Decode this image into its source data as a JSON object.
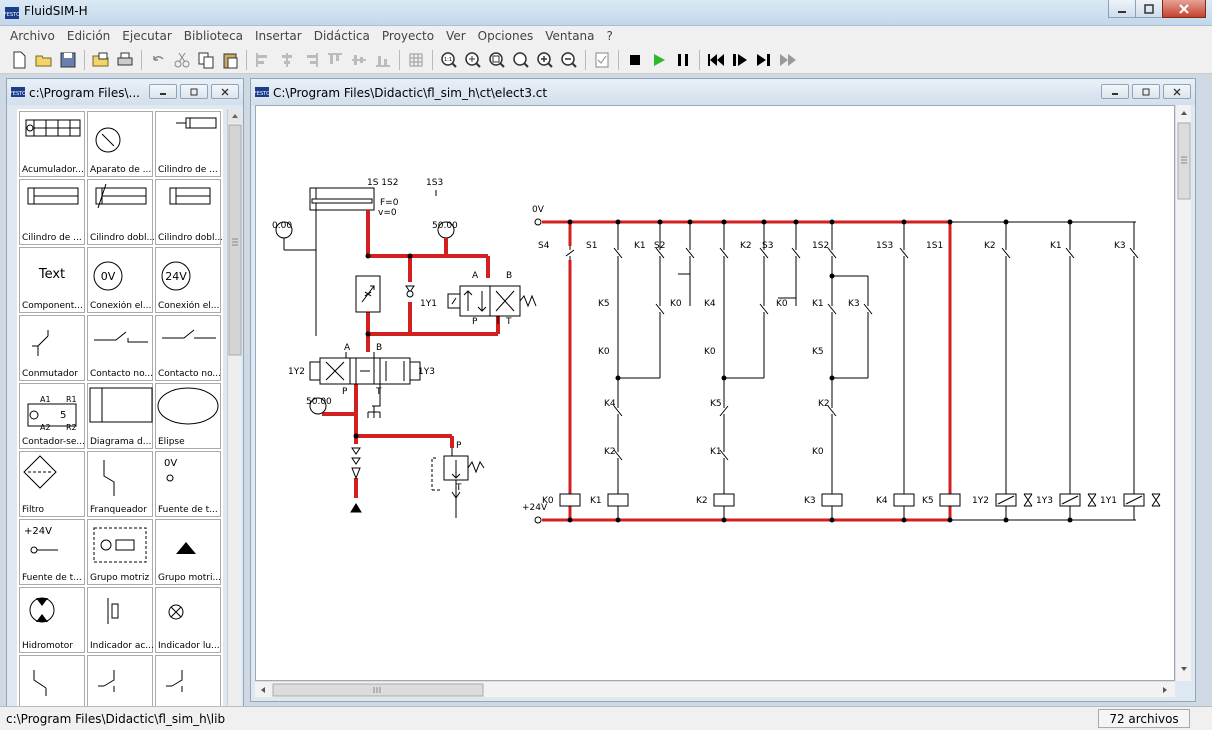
{
  "app": {
    "title": "FluidSIM-H"
  },
  "menu": [
    "Archivo",
    "Edición",
    "Ejecutar",
    "Biblioteca",
    "Insertar",
    "Didáctica",
    "Proyecto",
    "Ver",
    "Opciones",
    "Ventana",
    "?"
  ],
  "toolbar": [
    {
      "icon": "new-file-icon"
    },
    {
      "icon": "open-folder-icon"
    },
    {
      "icon": "save-icon"
    },
    {
      "sep": true
    },
    {
      "icon": "open-library-icon"
    },
    {
      "icon": "print-icon"
    },
    {
      "sep": true
    },
    {
      "icon": "undo-icon"
    },
    {
      "icon": "cut-icon"
    },
    {
      "icon": "copy-icon"
    },
    {
      "icon": "paste-icon"
    },
    {
      "sep": true
    },
    {
      "icon": "align-left-icon"
    },
    {
      "icon": "align-center-icon"
    },
    {
      "icon": "align-right-icon"
    },
    {
      "icon": "align-top-icon"
    },
    {
      "icon": "align-middle-icon"
    },
    {
      "icon": "align-bottom-icon"
    },
    {
      "sep": true
    },
    {
      "icon": "grid-icon"
    },
    {
      "sep": true
    },
    {
      "icon": "zoom-100-icon"
    },
    {
      "icon": "zoom-fit-icon"
    },
    {
      "icon": "zoom-window-icon"
    },
    {
      "icon": "zoom-previous-icon"
    },
    {
      "icon": "zoom-in-icon"
    },
    {
      "icon": "zoom-out-icon"
    },
    {
      "sep": true
    },
    {
      "icon": "check-drawing-icon"
    },
    {
      "sep": true
    },
    {
      "icon": "stop-icon"
    },
    {
      "icon": "play-icon"
    },
    {
      "icon": "pause-icon"
    },
    {
      "sep": true
    },
    {
      "icon": "reset-icon"
    },
    {
      "icon": "step-mode-icon"
    },
    {
      "icon": "step-to-next-icon"
    },
    {
      "icon": "play-to-end-icon"
    }
  ],
  "library": {
    "title": "c:\\Program Files\\...",
    "items": [
      "Acumulador...",
      "Aparato de ...",
      "Cilindro de ...",
      "Cilindro de ...",
      "Cilindro dobl...",
      "Cilindro dobl...",
      "Component...",
      "Conexión el...",
      "Conexión el...",
      "Conmutador",
      "Contacto no...",
      "Contacto no...",
      "Contador-se...",
      "Diagrama d...",
      "Elipse",
      "Filtro",
      "Franqueador",
      "Fuente de t...",
      "Fuente de t...",
      "Grupo motriz",
      "Grupo motri...",
      "Hidromotor",
      "Indicador ac...",
      "Indicador lu...",
      "",
      "",
      ""
    ],
    "glyph_text": {
      "text": "Text",
      "ov": "0V",
      "v24": "24V",
      "src_0v": "0V",
      "src_24v": "+24V",
      "counter_a1": "A1",
      "counter_a2": "A2",
      "counter_r1": "R1",
      "counter_r2": "R2",
      "counter_num": "5"
    }
  },
  "circuit": {
    "title": "C:\\Program Files\\Didactic\\fl_sim_h\\ct\\elect3.ct",
    "hyd": {
      "p1": "0.00",
      "p2": "50.00",
      "p3": "50.00",
      "cyl_force": "F=0",
      "cyl_speed": "v=0",
      "s1s2": "1S 1S2",
      "s3": "1S3",
      "val1y1": "1Y1",
      "port_a": "A",
      "port_b": "B",
      "port_p": "P",
      "port_t": "T",
      "y2": "1Y2",
      "y3": "1Y3",
      "main_a": "A",
      "main_b": "B",
      "main_p": "P",
      "main_t": "T",
      "pump_p": "P",
      "pump_t": "T"
    },
    "elec": {
      "ov": "0V",
      "v24": "+24V",
      "top_labels": [
        "S4",
        "S1",
        "K1",
        "S2",
        "K2",
        "S3",
        "1S2",
        "1S3",
        "1S1",
        "K2",
        "K1",
        "K3"
      ],
      "mid_labels": [
        "K5",
        "K0",
        "K0",
        "K4",
        "K0",
        "K0",
        "K1",
        "K3",
        "K5"
      ],
      "coil_labels": [
        "K0",
        "K1",
        "K2",
        "K3",
        "K4",
        "K5",
        "1Y2",
        "1Y3",
        "1Y1"
      ],
      "series_labels": [
        "K4",
        "K2",
        "K5",
        "K1",
        "K2",
        "K0"
      ]
    }
  },
  "status": {
    "path": "c:\\Program Files\\Didactic\\fl_sim_h\\lib",
    "count": "72 archivos"
  },
  "colors": {
    "active_line": "#d21f1f",
    "wire": "#000000"
  }
}
